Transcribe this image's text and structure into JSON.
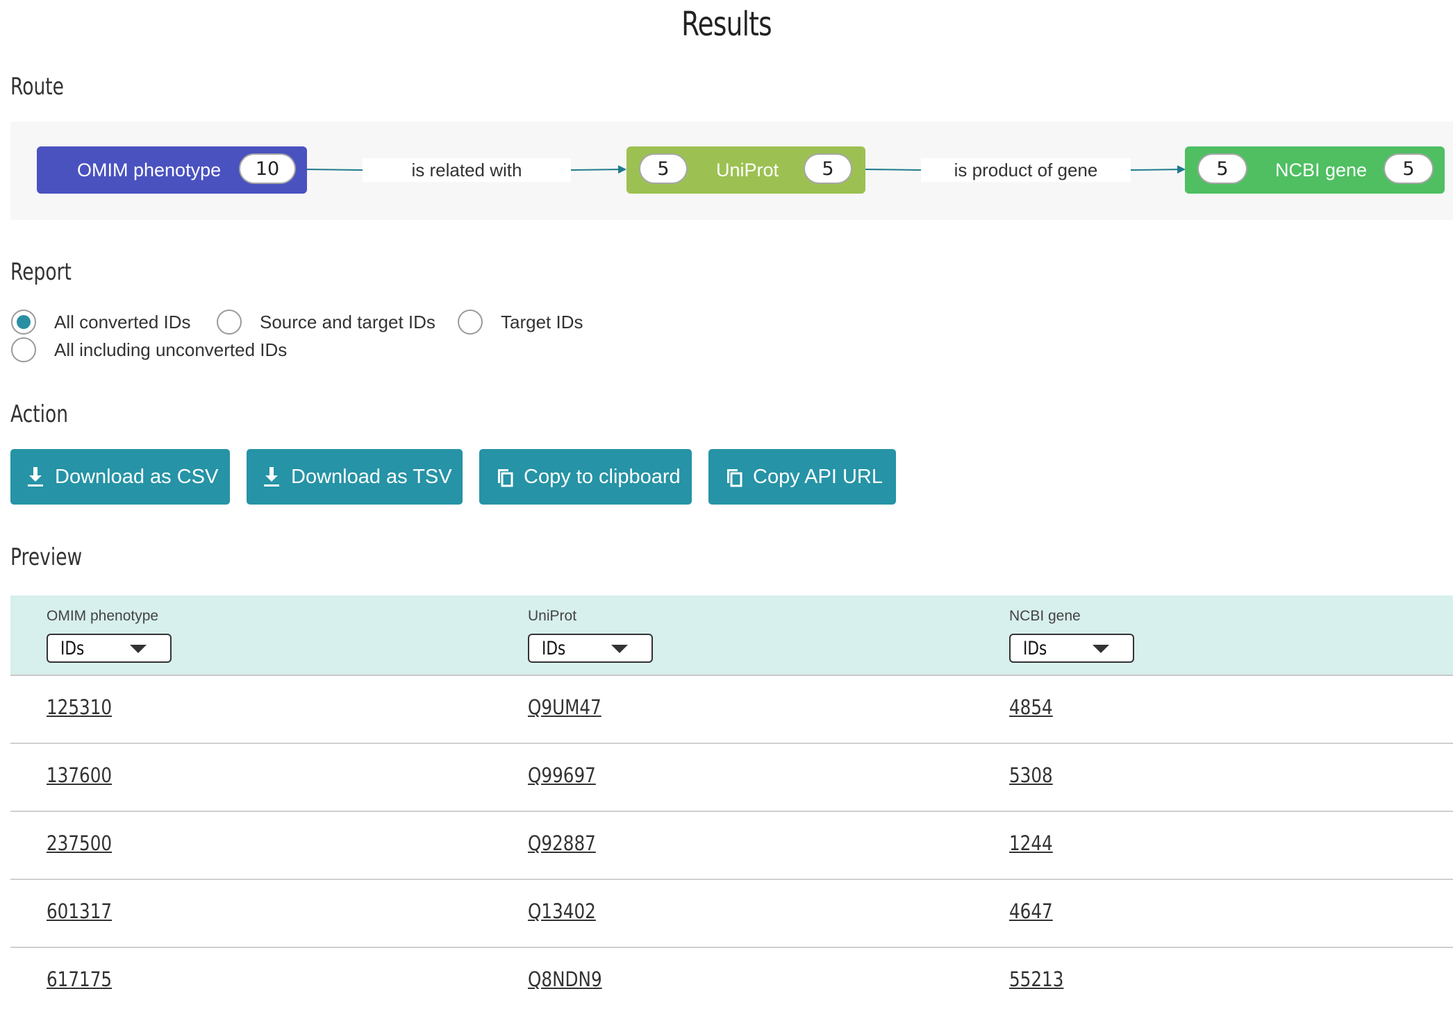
{
  "page": {
    "title": "Results"
  },
  "sections": {
    "route": "Route",
    "report": "Report",
    "action": "Action",
    "preview": "Preview"
  },
  "route": {
    "nodes": [
      {
        "label": "OMIM phenotype",
        "in_count": "",
        "out_count": "10",
        "color": "#4a52bf"
      },
      {
        "label": "UniProt",
        "in_count": "5",
        "out_count": "5",
        "color": "#9cc152"
      },
      {
        "label": "NCBI gene",
        "in_count": "5",
        "out_count": "5",
        "color": "#4fbf62"
      }
    ],
    "edges": [
      {
        "label": "is related with"
      },
      {
        "label": "is product of gene"
      }
    ],
    "arrow_color": "#1f7a8c"
  },
  "report": {
    "options": [
      {
        "label": "All converted IDs",
        "checked": true
      },
      {
        "label": "Source and target IDs",
        "checked": false
      },
      {
        "label": "Target IDs",
        "checked": false
      },
      {
        "label": "All including unconverted IDs",
        "checked": false
      }
    ]
  },
  "actions": {
    "download_csv": "Download as CSV",
    "download_tsv": "Download as TSV",
    "copy_clipboard": "Copy to clipboard",
    "copy_api_url": "Copy API URL",
    "button_color": "#2693a6"
  },
  "preview": {
    "columns": [
      {
        "title": "OMIM phenotype",
        "select": "IDs"
      },
      {
        "title": "UniProt",
        "select": "IDs"
      },
      {
        "title": "NCBI gene",
        "select": "IDs"
      }
    ],
    "rows": [
      [
        "125310",
        "Q9UM47",
        "4854"
      ],
      [
        "137600",
        "Q99697",
        "5308"
      ],
      [
        "237500",
        "Q92887",
        "1244"
      ],
      [
        "601317",
        "Q13402",
        "4647"
      ],
      [
        "617175",
        "Q8NDN9",
        "55213"
      ]
    ],
    "header_color": "#d7efed"
  }
}
